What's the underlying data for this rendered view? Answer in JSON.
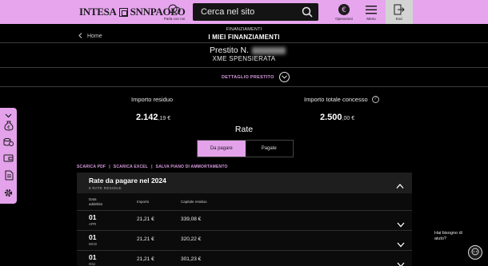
{
  "header": {
    "brand": "INTESA SANPAOLO",
    "brand_left": "INTESA",
    "brand_right": "SNNPAOLO",
    "talk_label": "Parla con noi",
    "search_placeholder": "Cerca nel sito",
    "operations_label": "Operazioni",
    "menu_label": "Menu",
    "exit_label": "Esci"
  },
  "breadcrumb": "FINANZIAMENTI",
  "back_link": "Home",
  "page_title": "I MIEI FINANZIAMENTI",
  "loan": {
    "number_label": "Prestito N.",
    "name": "XME SPENSIERATA",
    "detail_link": "DETTAGLIO PRESTITO"
  },
  "amounts": {
    "residual_label": "Importo residuo",
    "residual_int": "2.142",
    "residual_dec": ",19 €",
    "granted_label": "Importo totale concesso",
    "granted_int": "2.500",
    "granted_dec": ",00 €"
  },
  "rate_title": "Rate",
  "tabs": {
    "to_pay": "Da pagare",
    "paid": "Pagate",
    "active": "to_pay"
  },
  "downloads": {
    "pdf": "SCARICA PDF",
    "excel": "SCARICA EXCEL",
    "plan": "SALVA PIANO DI AMMORTAMENTO",
    "separator": "|"
  },
  "installments": {
    "title": "Rate da pagare nel 2024",
    "subtitle": "8 RATE RESIDUE",
    "columns": {
      "date_line1": "Data",
      "date_line2": "addebito",
      "amount": "Importo",
      "capital": "Capitale residuo"
    },
    "rows": [
      {
        "day": "01",
        "month": "APR",
        "amount": "21,21 €",
        "capital": "339,08 €"
      },
      {
        "day": "01",
        "month": "MAG",
        "amount": "21,21 €",
        "capital": "320,22 €"
      },
      {
        "day": "01",
        "month": "GIU",
        "amount": "21,21 €",
        "capital": "301,23 €"
      }
    ]
  },
  "help": {
    "text": "Hai bisogno di aiuto?"
  },
  "colors": {
    "accent": "#e4a2eb",
    "link": "#d79be0",
    "background": "#000000",
    "panel_header": "#1e1e1e"
  },
  "icons": {
    "talk": "chat-bubbles-icon",
    "search": "search-icon",
    "operations": "euro-circle-icon",
    "menu": "hamburger-icon",
    "exit": "logout-icon",
    "side": [
      "collapse-icon",
      "money-bag-icon",
      "coins-icon",
      "wallet-icon",
      "document-icon",
      "settings-icon"
    ]
  }
}
